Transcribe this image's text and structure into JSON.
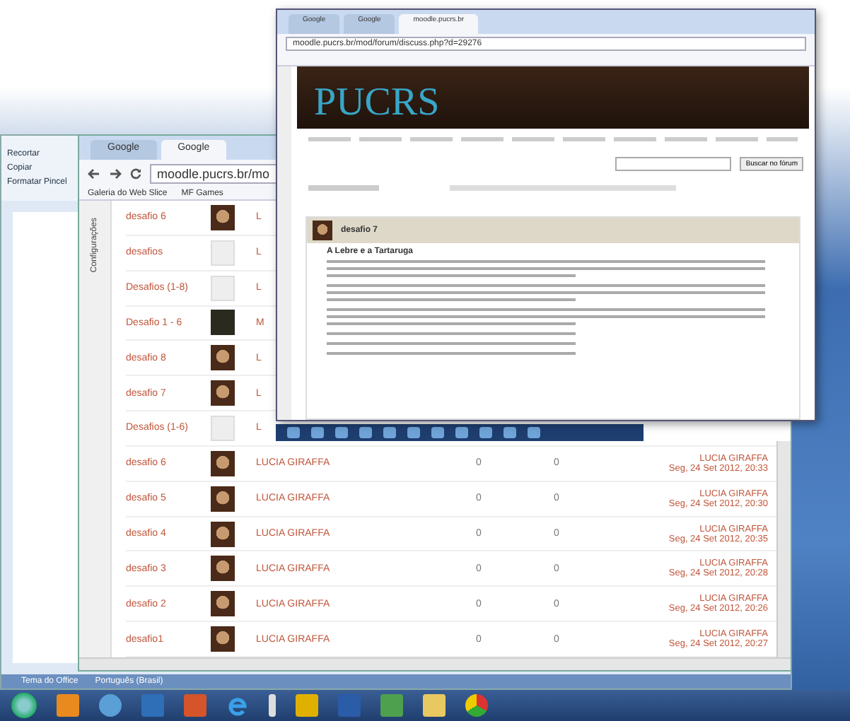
{
  "word_window": {
    "ribbon_items": [
      "Recortar",
      "Copiar",
      "Formatar Pincel"
    ],
    "status_bar": [
      "Tema do Office",
      "Português (Brasil)"
    ]
  },
  "back_browser": {
    "tabs": [
      {
        "label": "Google",
        "selected": false
      },
      {
        "label": "Google",
        "selected": true
      }
    ],
    "address": "moodle.pucrs.br/mo",
    "bookmarks": [
      "Galeria do Web Slice",
      "MF Games"
    ],
    "sidebar_label": "Configurações",
    "rows": [
      {
        "topic": "desafio 6",
        "avatar": {
          "kind": "photo"
        },
        "author": "L"
      },
      {
        "topic": "desafios",
        "avatar": {
          "kind": "blank"
        },
        "author": "L"
      },
      {
        "topic": "Desafios (1-8)",
        "avatar": {
          "kind": "blank"
        },
        "author": "L"
      },
      {
        "topic": "Desafio 1 - 6",
        "avatar": {
          "kind": "dark"
        },
        "author": "M"
      },
      {
        "topic": "desafio 8",
        "avatar": {
          "kind": "photo"
        },
        "author": "L"
      },
      {
        "topic": "desafio 7",
        "avatar": {
          "kind": "photo"
        },
        "author": "L"
      },
      {
        "topic": "Desafios (1-6)",
        "avatar": {
          "kind": "blank"
        },
        "author": "L"
      },
      {
        "topic": "desafio 6",
        "avatar": {
          "kind": "photo"
        },
        "author": "LUCIA GIRAFFA",
        "replies": "0",
        "unread": "0",
        "last_by": "LUCIA GIRAFFA",
        "last_date": "Seg, 24 Set 2012, 20:33"
      },
      {
        "topic": "desafio 5",
        "avatar": {
          "kind": "photo"
        },
        "author": "LUCIA GIRAFFA",
        "replies": "0",
        "unread": "0",
        "last_by": "LUCIA GIRAFFA",
        "last_date": "Seg, 24 Set 2012, 20:30"
      },
      {
        "topic": "desafio 4",
        "avatar": {
          "kind": "photo"
        },
        "author": "LUCIA GIRAFFA",
        "replies": "0",
        "unread": "0",
        "last_by": "LUCIA GIRAFFA",
        "last_date": "Seg, 24 Set 2012, 20:35"
      },
      {
        "topic": "desafio 3",
        "avatar": {
          "kind": "photo"
        },
        "author": "LUCIA GIRAFFA",
        "replies": "0",
        "unread": "0",
        "last_by": "LUCIA GIRAFFA",
        "last_date": "Seg, 24 Set 2012, 20:28"
      },
      {
        "topic": "desafio 2",
        "avatar": {
          "kind": "photo"
        },
        "author": "LUCIA GIRAFFA",
        "replies": "0",
        "unread": "0",
        "last_by": "LUCIA GIRAFFA",
        "last_date": "Seg, 24 Set 2012, 20:26"
      },
      {
        "topic": "desafio1",
        "avatar": {
          "kind": "photo"
        },
        "author": "LUCIA GIRAFFA",
        "replies": "0",
        "unread": "0",
        "last_by": "LUCIA GIRAFFA",
        "last_date": "Seg, 24 Set 2012, 20:27"
      }
    ]
  },
  "front_browser": {
    "tabs": [
      {
        "label": "Google",
        "selected": false
      },
      {
        "label": "Google",
        "selected": false
      },
      {
        "label": "moodle.pucrs.br",
        "selected": true
      }
    ],
    "address": "moodle.pucrs.br/mod/forum/discuss.php?d=29276",
    "logo": "PUCRS",
    "search_button": "Buscar no fórum",
    "post": {
      "title": "desafio 7",
      "heading": "A Lebre e a Tartaruga"
    }
  }
}
